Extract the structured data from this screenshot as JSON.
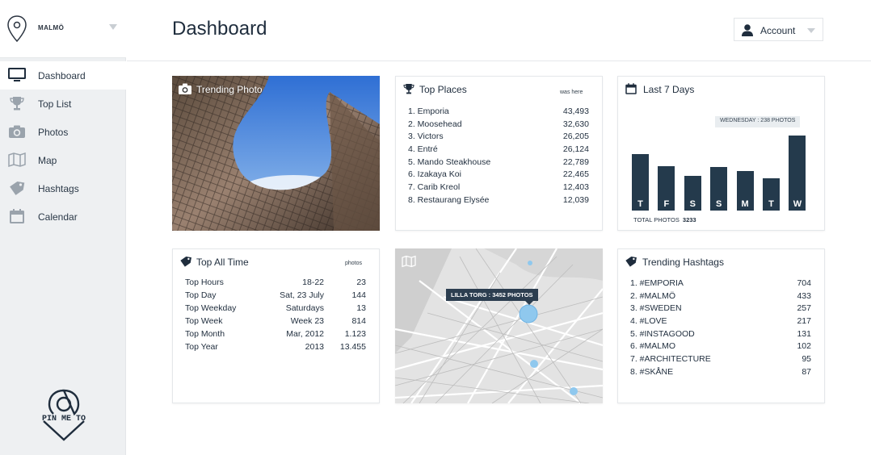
{
  "city": {
    "name": "MALMÖ"
  },
  "sidebar": {
    "items": [
      {
        "label": "Dashboard",
        "icon": "monitor-icon"
      },
      {
        "label": "Top List",
        "icon": "trophy-icon"
      },
      {
        "label": "Photos",
        "icon": "camera-icon"
      },
      {
        "label": "Map",
        "icon": "map-icon"
      },
      {
        "label": "Hashtags",
        "icon": "tag-icon"
      },
      {
        "label": "Calendar",
        "icon": "calendar-icon"
      }
    ],
    "logo_text": "PIN ME TO"
  },
  "header": {
    "title": "Dashboard",
    "account_label": "Account"
  },
  "trending_photo": {
    "title": "Trending Photo"
  },
  "top_places": {
    "title": "Top Places",
    "column_label": "was here",
    "rows": [
      {
        "name": "1. Emporia",
        "value": "43,493"
      },
      {
        "name": "2. Moosehead",
        "value": "32,630"
      },
      {
        "name": "3. Victors",
        "value": "26,205"
      },
      {
        "name": "4. Entré",
        "value": "26,124"
      },
      {
        "name": "5. Mando Steakhouse",
        "value": "22,789"
      },
      {
        "name": "6. Izakaya Koi",
        "value": "22,465"
      },
      {
        "name": "7. Carib Kreol",
        "value": "12,403"
      },
      {
        "name": "8. Restaurang Elysée",
        "value": "12,039"
      }
    ]
  },
  "last_7_days": {
    "title": "Last 7 Days",
    "tooltip": "WEDNESDAY : 238 PHOTOS",
    "total_label": "TOTAL PHOTOS",
    "total_value": "3233",
    "days": [
      "T",
      "F",
      "S",
      "S",
      "M",
      "T",
      "W"
    ],
    "values": [
      178,
      140,
      110,
      137,
      126,
      102,
      238
    ],
    "bar_color": "#243a4c"
  },
  "top_all_time": {
    "title": "Top All Time",
    "column_label": "photos",
    "rows": [
      {
        "label": "Top Hours",
        "detail": "18-22",
        "value": "23"
      },
      {
        "label": "Top Day",
        "detail": "Sat, 23 July",
        "value": "144"
      },
      {
        "label": "Top Weekday",
        "detail": "Saturdays",
        "value": "13"
      },
      {
        "label": "Top Week",
        "detail": "Week 23",
        "value": "814"
      },
      {
        "label": "Top Month",
        "detail": "Mar, 2012",
        "value": "1.123"
      },
      {
        "label": "Top Year",
        "detail": "2013",
        "value": "13.455"
      }
    ]
  },
  "map": {
    "tooltip": "LILLA TORG : 3452 PHOTOS",
    "marker_color": "#8fc8ee"
  },
  "trending_hashtags": {
    "title": "Trending Hashtags",
    "rows": [
      {
        "name": "1. #EMPORIA",
        "value": "704"
      },
      {
        "name": "2. #MALMÖ",
        "value": "433"
      },
      {
        "name": "3. #SWEDEN",
        "value": "257"
      },
      {
        "name": "4. #LOVE",
        "value": "217"
      },
      {
        "name": "5. #INSTAGOOD",
        "value": "131"
      },
      {
        "name": "6. #MALMO",
        "value": "102"
      },
      {
        "name": "7. #ARCHITECTURE",
        "value": "95"
      },
      {
        "name": "8. #SKÅNE",
        "value": "87"
      }
    ]
  }
}
